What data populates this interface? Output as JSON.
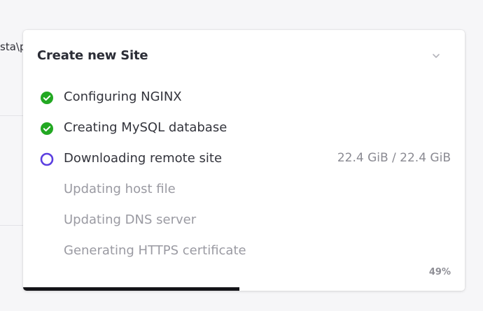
{
  "background": {
    "path_fragment": "sta\\p"
  },
  "panel": {
    "title": "Create new Site",
    "collapse_icon": "chevron-down-icon",
    "steps": [
      {
        "label": "Configuring NGINX",
        "status": "done",
        "icon": "check-circle-icon"
      },
      {
        "label": "Creating MySQL database",
        "status": "done",
        "icon": "check-circle-icon"
      },
      {
        "label": "Downloading remote site",
        "status": "active",
        "icon": "ring-icon",
        "progress": "22.4 GiB / 22.4 GiB"
      },
      {
        "label": "Updating host file",
        "status": "pending"
      },
      {
        "label": "Updating DNS server",
        "status": "pending"
      },
      {
        "label": "Generating HTTPS certificate",
        "status": "pending"
      }
    ],
    "percent_label": "49%",
    "progress_fraction": 0.49
  },
  "colors": {
    "success": "#22a822",
    "active": "#5b3fe0",
    "progress_bar": "#141418"
  }
}
